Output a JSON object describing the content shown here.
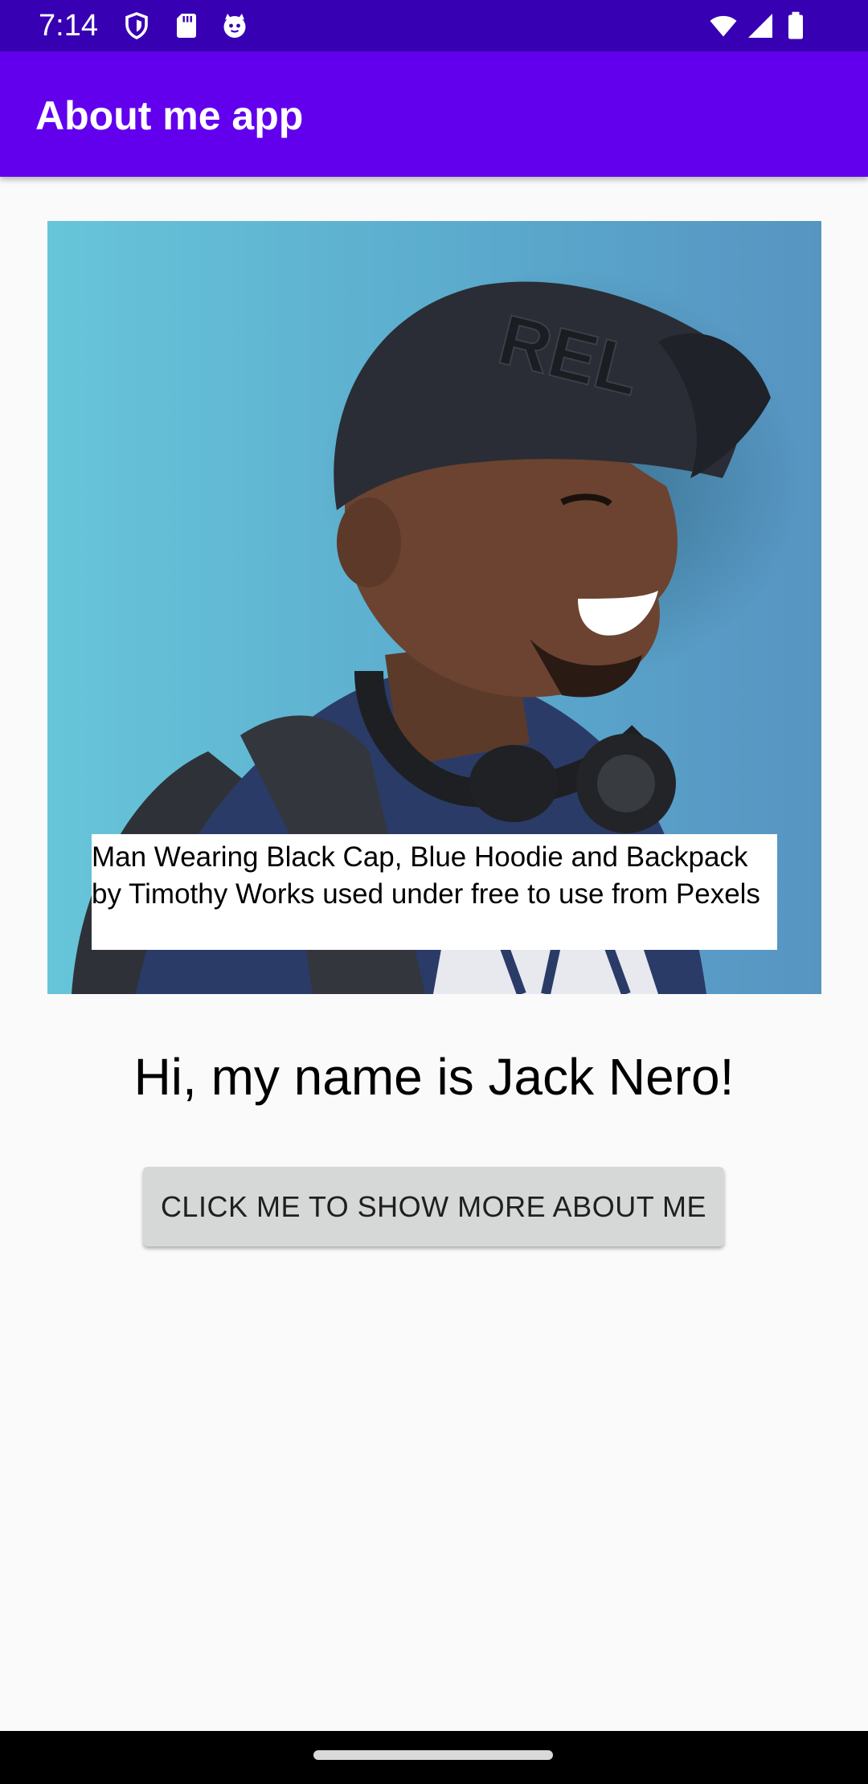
{
  "status_bar": {
    "time": "7:14",
    "left_icons": [
      "shield-icon",
      "sd-card-icon",
      "cat-face-icon"
    ],
    "right_icons": [
      "wifi-icon",
      "signal-icon",
      "battery-icon"
    ]
  },
  "app_bar": {
    "title": "About me app"
  },
  "photo": {
    "caption": "Man Wearing Black Cap, Blue Hoodie and Backpack by Timothy Works used under free to use from Pexels",
    "cap_text": "REL"
  },
  "main": {
    "greeting": "Hi, my name is Jack Nero!",
    "button_label": "CLICK ME TO SHOW MORE ABOUT ME"
  },
  "colors": {
    "status_bar": "#3700b3",
    "app_bar": "#6200ee",
    "background": "#fafafa",
    "button": "#d6d7d7"
  }
}
